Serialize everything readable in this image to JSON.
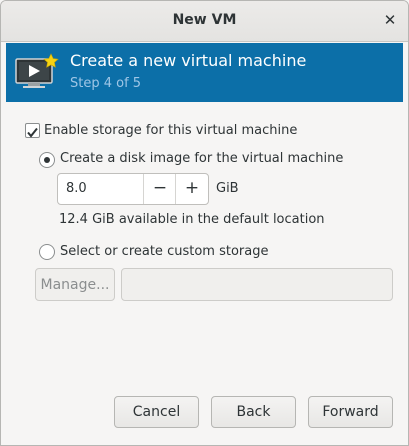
{
  "window": {
    "title": "New VM"
  },
  "banner": {
    "title": "Create a new virtual machine",
    "step": "Step 4 of 5",
    "icon": "vm-monitor-star-icon"
  },
  "storage": {
    "enable_label": "Enable storage for this virtual machine",
    "enable_checked": true,
    "disk_image_label": "Create a disk image for the virtual machine",
    "disk_image_selected": true,
    "size_value": "8.0",
    "size_unit": "GiB",
    "decrement_label": "−",
    "increment_label": "+",
    "available_text": "12.4 GiB available in the default location",
    "custom_label": "Select or create custom storage",
    "custom_selected": false,
    "manage_label": "Manage...",
    "custom_path_value": ""
  },
  "actions": {
    "cancel": "Cancel",
    "back": "Back",
    "forward": "Forward"
  },
  "colors": {
    "banner_bg": "#0c6fa8",
    "banner_subtitle": "#9fc6e6"
  }
}
